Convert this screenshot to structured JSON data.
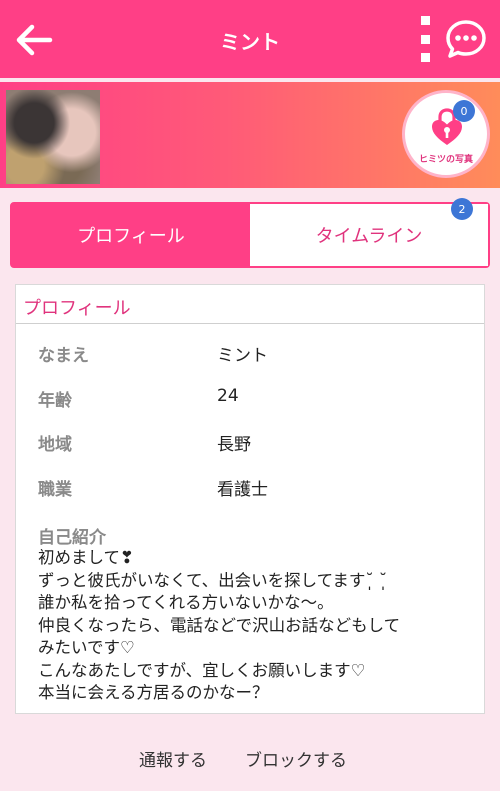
{
  "header": {
    "title": "ミント",
    "back_icon": "arrow-left-icon",
    "menu_icon": "kebab-menu-icon",
    "chat_icon": "chat-bubble-icon",
    "color": "#ff3f86"
  },
  "banner": {
    "secret_photo_label": "ヒミツの写真",
    "secret_photo_badge": "0"
  },
  "tabs": {
    "profile": "プロフィール",
    "timeline": "タイムライン",
    "timeline_badge": "2"
  },
  "profile": {
    "heading": "プロフィール",
    "rows": [
      {
        "label": "なまえ",
        "value": "ミント"
      },
      {
        "label": "年齢",
        "value": "24"
      },
      {
        "label": "地域",
        "value": "長野"
      },
      {
        "label": "職業",
        "value": "看護士"
      }
    ],
    "bio_label": "自己紹介",
    "bio": "初めまして❣\nずっと彼氏がいなくて、出会いを探してます˘̩̩̩ ˘̩̩̩\n誰か私を拾ってくれる方いないかな〜。\n仲良くなったら、電話などで沢山お話などもして\nみたいです♡\nこんなあたしですが、宜しくお願いします♡\n本当に会える方居るのかなー？"
  },
  "footer": {
    "report": "通報する",
    "block": "ブロックする"
  }
}
